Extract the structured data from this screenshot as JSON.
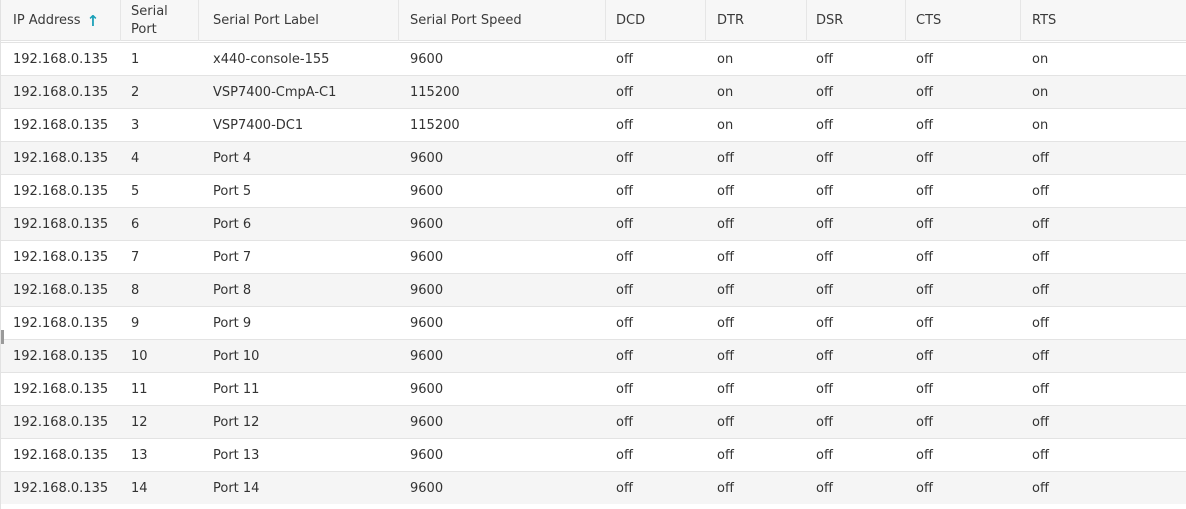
{
  "headers": {
    "ip_address": "IP Address",
    "sort_indicator": "↑",
    "serial_port": "Serial Port",
    "serial_port_label": "Serial Port Label",
    "serial_port_speed": "Serial Port Speed",
    "dcd": "DCD",
    "dtr": "DTR",
    "dsr": "DSR",
    "cts": "CTS",
    "rts": "RTS"
  },
  "colors": {
    "sort_icon": "#1aa0b8",
    "row_alt": "#f5f5f5",
    "header_bg": "#f7f7f7"
  },
  "rows": [
    {
      "ip": "192.168.0.135",
      "port": "1",
      "label": "x440-console-155",
      "speed": "9600",
      "dcd": "off",
      "dtr": "on",
      "dsr": "off",
      "cts": "off",
      "rts": "on"
    },
    {
      "ip": "192.168.0.135",
      "port": "2",
      "label": "VSP7400-CmpA-C1",
      "speed": "115200",
      "dcd": "off",
      "dtr": "on",
      "dsr": "off",
      "cts": "off",
      "rts": "on"
    },
    {
      "ip": "192.168.0.135",
      "port": "3",
      "label": "VSP7400-DC1",
      "speed": "115200",
      "dcd": "off",
      "dtr": "on",
      "dsr": "off",
      "cts": "off",
      "rts": "on"
    },
    {
      "ip": "192.168.0.135",
      "port": "4",
      "label": "Port 4",
      "speed": "9600",
      "dcd": "off",
      "dtr": "off",
      "dsr": "off",
      "cts": "off",
      "rts": "off"
    },
    {
      "ip": "192.168.0.135",
      "port": "5",
      "label": "Port 5",
      "speed": "9600",
      "dcd": "off",
      "dtr": "off",
      "dsr": "off",
      "cts": "off",
      "rts": "off"
    },
    {
      "ip": "192.168.0.135",
      "port": "6",
      "label": "Port 6",
      "speed": "9600",
      "dcd": "off",
      "dtr": "off",
      "dsr": "off",
      "cts": "off",
      "rts": "off"
    },
    {
      "ip": "192.168.0.135",
      "port": "7",
      "label": "Port 7",
      "speed": "9600",
      "dcd": "off",
      "dtr": "off",
      "dsr": "off",
      "cts": "off",
      "rts": "off"
    },
    {
      "ip": "192.168.0.135",
      "port": "8",
      "label": "Port 8",
      "speed": "9600",
      "dcd": "off",
      "dtr": "off",
      "dsr": "off",
      "cts": "off",
      "rts": "off"
    },
    {
      "ip": "192.168.0.135",
      "port": "9",
      "label": "Port 9",
      "speed": "9600",
      "dcd": "off",
      "dtr": "off",
      "dsr": "off",
      "cts": "off",
      "rts": "off"
    },
    {
      "ip": "192.168.0.135",
      "port": "10",
      "label": "Port 10",
      "speed": "9600",
      "dcd": "off",
      "dtr": "off",
      "dsr": "off",
      "cts": "off",
      "rts": "off"
    },
    {
      "ip": "192.168.0.135",
      "port": "11",
      "label": "Port 11",
      "speed": "9600",
      "dcd": "off",
      "dtr": "off",
      "dsr": "off",
      "cts": "off",
      "rts": "off"
    },
    {
      "ip": "192.168.0.135",
      "port": "12",
      "label": "Port 12",
      "speed": "9600",
      "dcd": "off",
      "dtr": "off",
      "dsr": "off",
      "cts": "off",
      "rts": "off"
    },
    {
      "ip": "192.168.0.135",
      "port": "13",
      "label": "Port 13",
      "speed": "9600",
      "dcd": "off",
      "dtr": "off",
      "dsr": "off",
      "cts": "off",
      "rts": "off"
    },
    {
      "ip": "192.168.0.135",
      "port": "14",
      "label": "Port 14",
      "speed": "9600",
      "dcd": "off",
      "dtr": "off",
      "dsr": "off",
      "cts": "off",
      "rts": "off"
    }
  ]
}
